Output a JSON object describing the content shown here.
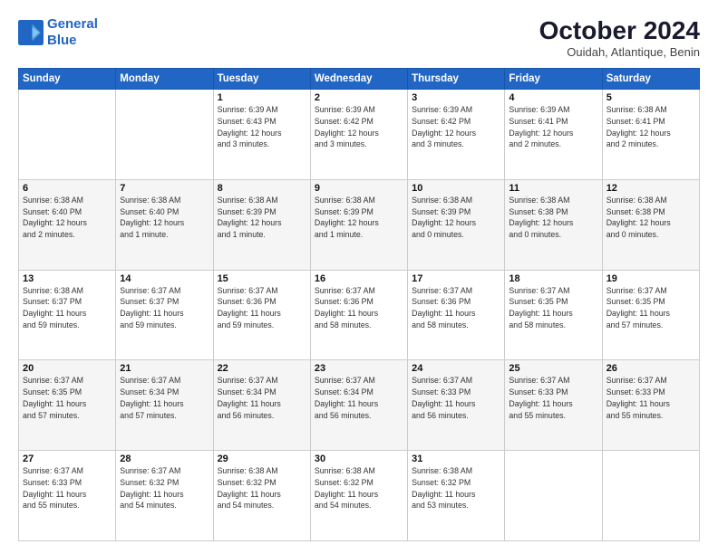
{
  "header": {
    "logo": {
      "line1": "General",
      "line2": "Blue"
    },
    "title": "October 2024",
    "subtitle": "Ouidah, Atlantique, Benin"
  },
  "weekdays": [
    "Sunday",
    "Monday",
    "Tuesday",
    "Wednesday",
    "Thursday",
    "Friday",
    "Saturday"
  ],
  "weeks": [
    [
      {
        "day": "",
        "info": ""
      },
      {
        "day": "",
        "info": ""
      },
      {
        "day": "1",
        "info": "Sunrise: 6:39 AM\nSunset: 6:43 PM\nDaylight: 12 hours\nand 3 minutes."
      },
      {
        "day": "2",
        "info": "Sunrise: 6:39 AM\nSunset: 6:42 PM\nDaylight: 12 hours\nand 3 minutes."
      },
      {
        "day": "3",
        "info": "Sunrise: 6:39 AM\nSunset: 6:42 PM\nDaylight: 12 hours\nand 3 minutes."
      },
      {
        "day": "4",
        "info": "Sunrise: 6:39 AM\nSunset: 6:41 PM\nDaylight: 12 hours\nand 2 minutes."
      },
      {
        "day": "5",
        "info": "Sunrise: 6:38 AM\nSunset: 6:41 PM\nDaylight: 12 hours\nand 2 minutes."
      }
    ],
    [
      {
        "day": "6",
        "info": "Sunrise: 6:38 AM\nSunset: 6:40 PM\nDaylight: 12 hours\nand 2 minutes."
      },
      {
        "day": "7",
        "info": "Sunrise: 6:38 AM\nSunset: 6:40 PM\nDaylight: 12 hours\nand 1 minute."
      },
      {
        "day": "8",
        "info": "Sunrise: 6:38 AM\nSunset: 6:39 PM\nDaylight: 12 hours\nand 1 minute."
      },
      {
        "day": "9",
        "info": "Sunrise: 6:38 AM\nSunset: 6:39 PM\nDaylight: 12 hours\nand 1 minute."
      },
      {
        "day": "10",
        "info": "Sunrise: 6:38 AM\nSunset: 6:39 PM\nDaylight: 12 hours\nand 0 minutes."
      },
      {
        "day": "11",
        "info": "Sunrise: 6:38 AM\nSunset: 6:38 PM\nDaylight: 12 hours\nand 0 minutes."
      },
      {
        "day": "12",
        "info": "Sunrise: 6:38 AM\nSunset: 6:38 PM\nDaylight: 12 hours\nand 0 minutes."
      }
    ],
    [
      {
        "day": "13",
        "info": "Sunrise: 6:38 AM\nSunset: 6:37 PM\nDaylight: 11 hours\nand 59 minutes."
      },
      {
        "day": "14",
        "info": "Sunrise: 6:37 AM\nSunset: 6:37 PM\nDaylight: 11 hours\nand 59 minutes."
      },
      {
        "day": "15",
        "info": "Sunrise: 6:37 AM\nSunset: 6:36 PM\nDaylight: 11 hours\nand 59 minutes."
      },
      {
        "day": "16",
        "info": "Sunrise: 6:37 AM\nSunset: 6:36 PM\nDaylight: 11 hours\nand 58 minutes."
      },
      {
        "day": "17",
        "info": "Sunrise: 6:37 AM\nSunset: 6:36 PM\nDaylight: 11 hours\nand 58 minutes."
      },
      {
        "day": "18",
        "info": "Sunrise: 6:37 AM\nSunset: 6:35 PM\nDaylight: 11 hours\nand 58 minutes."
      },
      {
        "day": "19",
        "info": "Sunrise: 6:37 AM\nSunset: 6:35 PM\nDaylight: 11 hours\nand 57 minutes."
      }
    ],
    [
      {
        "day": "20",
        "info": "Sunrise: 6:37 AM\nSunset: 6:35 PM\nDaylight: 11 hours\nand 57 minutes."
      },
      {
        "day": "21",
        "info": "Sunrise: 6:37 AM\nSunset: 6:34 PM\nDaylight: 11 hours\nand 57 minutes."
      },
      {
        "day": "22",
        "info": "Sunrise: 6:37 AM\nSunset: 6:34 PM\nDaylight: 11 hours\nand 56 minutes."
      },
      {
        "day": "23",
        "info": "Sunrise: 6:37 AM\nSunset: 6:34 PM\nDaylight: 11 hours\nand 56 minutes."
      },
      {
        "day": "24",
        "info": "Sunrise: 6:37 AM\nSunset: 6:33 PM\nDaylight: 11 hours\nand 56 minutes."
      },
      {
        "day": "25",
        "info": "Sunrise: 6:37 AM\nSunset: 6:33 PM\nDaylight: 11 hours\nand 55 minutes."
      },
      {
        "day": "26",
        "info": "Sunrise: 6:37 AM\nSunset: 6:33 PM\nDaylight: 11 hours\nand 55 minutes."
      }
    ],
    [
      {
        "day": "27",
        "info": "Sunrise: 6:37 AM\nSunset: 6:33 PM\nDaylight: 11 hours\nand 55 minutes."
      },
      {
        "day": "28",
        "info": "Sunrise: 6:37 AM\nSunset: 6:32 PM\nDaylight: 11 hours\nand 54 minutes."
      },
      {
        "day": "29",
        "info": "Sunrise: 6:38 AM\nSunset: 6:32 PM\nDaylight: 11 hours\nand 54 minutes."
      },
      {
        "day": "30",
        "info": "Sunrise: 6:38 AM\nSunset: 6:32 PM\nDaylight: 11 hours\nand 54 minutes."
      },
      {
        "day": "31",
        "info": "Sunrise: 6:38 AM\nSunset: 6:32 PM\nDaylight: 11 hours\nand 53 minutes."
      },
      {
        "day": "",
        "info": ""
      },
      {
        "day": "",
        "info": ""
      }
    ]
  ]
}
